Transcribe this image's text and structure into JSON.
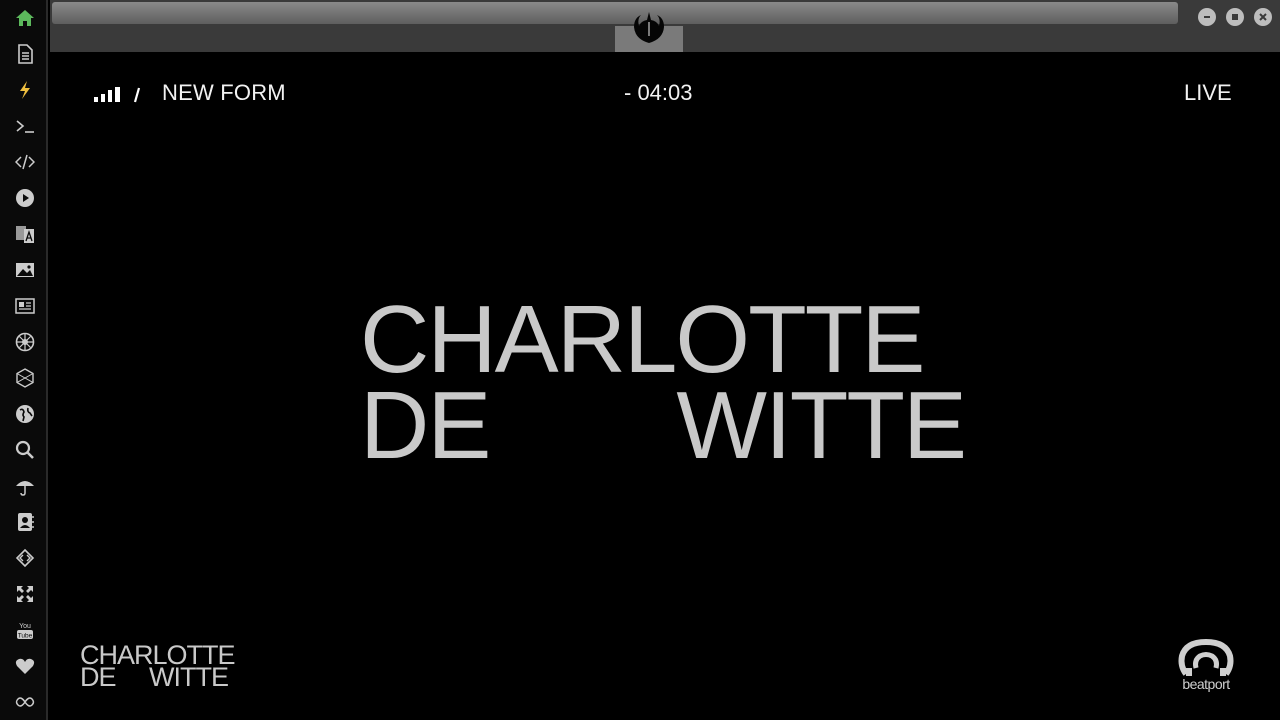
{
  "sidebar": {
    "items": [
      {
        "name": "home-icon",
        "color": "#5cb85c"
      },
      {
        "name": "document-icon",
        "color": "#cccccc"
      },
      {
        "name": "lightning-icon",
        "color": "#f0c040"
      },
      {
        "name": "terminal-icon",
        "color": "#cccccc"
      },
      {
        "name": "code-icon",
        "color": "#cccccc"
      },
      {
        "name": "play-icon",
        "color": "#cccccc"
      },
      {
        "name": "translate-icon",
        "color": "#cccccc"
      },
      {
        "name": "image-icon",
        "color": "#cccccc"
      },
      {
        "name": "news-icon",
        "color": "#cccccc"
      },
      {
        "name": "empire-icon",
        "color": "#cccccc"
      },
      {
        "name": "hexagon-icon",
        "color": "#cccccc"
      },
      {
        "name": "globe-icon",
        "color": "#cccccc"
      },
      {
        "name": "search-icon",
        "color": "#cccccc"
      },
      {
        "name": "umbrella-icon",
        "color": "#cccccc"
      },
      {
        "name": "contacts-icon",
        "color": "#cccccc"
      },
      {
        "name": "diamond-code-icon",
        "color": "#cccccc"
      },
      {
        "name": "expand-icon",
        "color": "#cccccc"
      },
      {
        "name": "youtube-icon",
        "color": "#cccccc"
      },
      {
        "name": "heart-icon",
        "color": "#cccccc"
      },
      {
        "name": "infinity-icon",
        "color": "#cccccc"
      }
    ]
  },
  "topbar": {
    "logo": "rebel-alliance-icon",
    "window_controls": [
      "minimize-icon",
      "maximize-icon",
      "close-icon"
    ]
  },
  "player": {
    "program_name": "NEW FORM",
    "remaining_time": "- 04:03",
    "status": "LIVE",
    "title_line1": "CHARLOTTE",
    "title_line2_left": "DE",
    "title_line2_right": "WITTE",
    "watermark_line1": "CHARLOTTE",
    "watermark_line2_left": "DE",
    "watermark_line2_right": "WITTE",
    "brand": "beatport"
  }
}
